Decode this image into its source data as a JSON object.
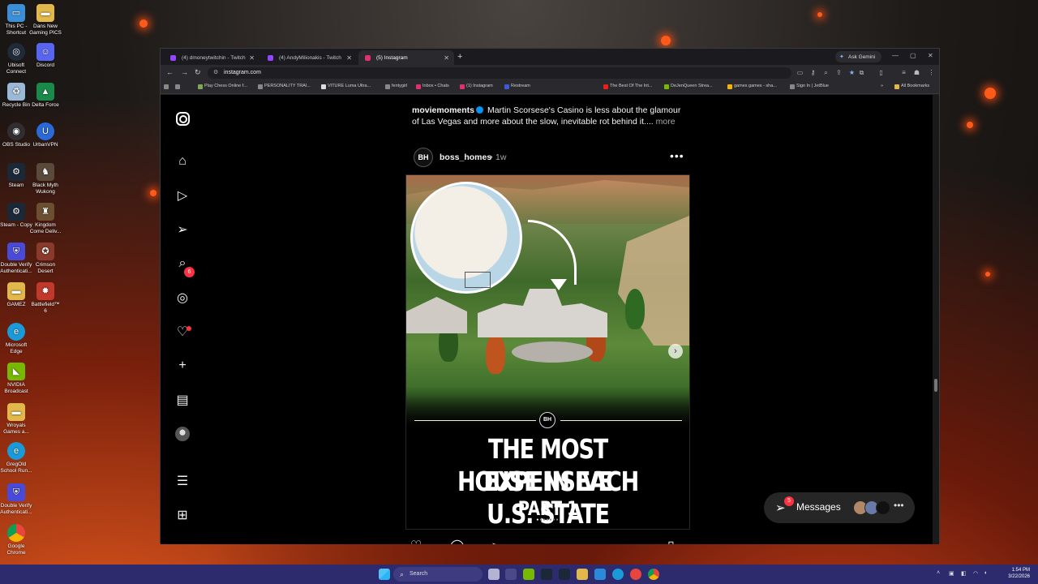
{
  "desktop": {
    "icons": [
      {
        "label": "This PC - Shortcut",
        "icon": "computer-icon",
        "color": "#3a8fd8"
      },
      {
        "label": "Dans New Gaming PICS",
        "icon": "folder-icon",
        "color": "#e2b84a"
      },
      {
        "label": "Ubisoft Connect",
        "icon": "ubisoft-icon",
        "color": "#1f2a3a"
      },
      {
        "label": "Discord",
        "icon": "discord-icon",
        "color": "#5865f2"
      },
      {
        "label": "Recycle Bin",
        "icon": "recycle-bin-icon",
        "color": "#9bb8d6"
      },
      {
        "label": "Delta Force",
        "icon": "delta-force-icon",
        "color": "#1a8a4a"
      },
      {
        "label": "OBS Studio",
        "icon": "obs-icon",
        "color": "#302e31"
      },
      {
        "label": "UrbanVPN",
        "icon": "vpn-icon",
        "color": "#2a6ad8"
      },
      {
        "label": "Steam",
        "icon": "steam-icon",
        "color": "#1b2838"
      },
      {
        "label": "Black Myth Wukong",
        "icon": "game-icon",
        "color": "#5a4a3a"
      },
      {
        "label": "Steam - Copy",
        "icon": "steam-icon",
        "color": "#1b2838"
      },
      {
        "label": "Kingdom Come Deliv...",
        "icon": "game-icon",
        "color": "#6a5030"
      },
      {
        "label": "Double Verify Authenticati...",
        "icon": "shield-icon",
        "color": "#4a4ad8"
      },
      {
        "label": "Crimson Desert",
        "icon": "game-icon",
        "color": "#8a3a2a"
      },
      {
        "label": "GAMEZ",
        "icon": "folder-icon",
        "color": "#e2b84a"
      },
      {
        "label": "Battlefield™ 6",
        "icon": "game-icon",
        "color": "#c0392b"
      },
      {
        "label": "Microsoft Edge",
        "icon": "edge-icon",
        "color": "#1a9ad8"
      },
      {
        "label": "NVIDIA Broadcast",
        "icon": "nvidia-icon",
        "color": "#76b900"
      },
      {
        "label": "Wroyals Games a...",
        "icon": "folder-icon",
        "color": "#e2b84a"
      },
      {
        "label": "GregOld School Run...",
        "icon": "edge-icon",
        "color": "#1a9ad8"
      },
      {
        "label": "Double Verify Authenticati...",
        "icon": "shield-icon",
        "color": "#4a4ad8"
      },
      {
        "label": "Google Chrome",
        "icon": "chrome-icon",
        "color": "#e8453c"
      }
    ]
  },
  "browser": {
    "tabs": [
      {
        "label": "(4) dmoneytwitchin - Twitch",
        "color": "#9146ff",
        "active": false
      },
      {
        "label": "(4) AndyMilionakis - Twitch",
        "color": "#9146ff",
        "active": false
      },
      {
        "label": "(5) Instagram",
        "color": "#e1306c",
        "active": true
      }
    ],
    "gemini_label": "Ask Gemini",
    "url": "instagram.com",
    "bookmarks": [
      {
        "label": "Play Chess Online f...",
        "color": "#7fa650"
      },
      {
        "label": "PERSONALITY TRAI...",
        "color": "#888888"
      },
      {
        "label": "VITURE Luma Ultra...",
        "color": "#dddddd"
      },
      {
        "label": "fentygirl",
        "color": "#888888"
      },
      {
        "label": "Inbox • Chats",
        "color": "#e1306c"
      },
      {
        "label": "(1) Instagram",
        "color": "#e1306c"
      },
      {
        "label": "Restream",
        "color": "#3a5ad8"
      },
      {
        "label": "The Best Of The Int...",
        "color": "#e62117"
      },
      {
        "label": "DeJenQueen Strea...",
        "color": "#76b900"
      },
      {
        "label": "games games - sha...",
        "color": "#f4b400"
      },
      {
        "label": "Sign In | JetBlue",
        "color": "#888888"
      },
      {
        "label": "All Bookmarks",
        "color": "#e2b84a"
      }
    ]
  },
  "instagram": {
    "sidebar": {
      "notifications_badge": "6"
    },
    "previous_post": {
      "username": "moviemoments",
      "caption": "Martin Scorsese's Casino is less about the glamour of Las Vegas and more about the slow, inevitable rot behind it....",
      "more_label": "more"
    },
    "post": {
      "avatar_text": "BH",
      "username": "boss_homes",
      "separator": "•",
      "time": "1w",
      "menu": "•••",
      "image_badge": "BH",
      "headline_line1": "THE MOST EXPENSIVE",
      "headline_line2": "HOUSE IN EACH U.S. STATE",
      "headline_line3": "PART 1",
      "carousel_count": 7,
      "carousel_index": 0
    },
    "messages": {
      "label": "Messages",
      "badge": "5"
    }
  },
  "taskbar": {
    "search_placeholder": "Search",
    "time": "1:54 PM",
    "date": "3/22/2026"
  }
}
